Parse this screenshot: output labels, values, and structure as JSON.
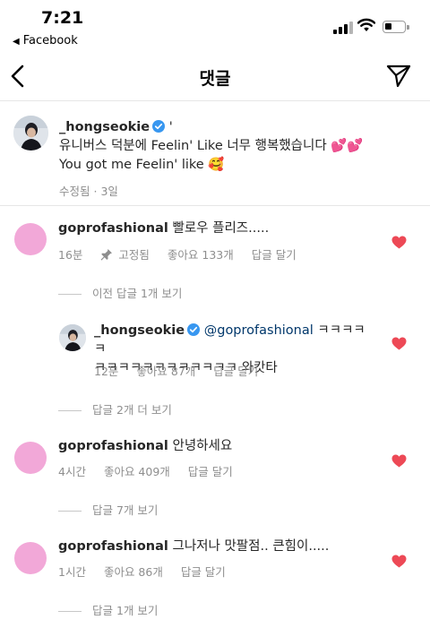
{
  "status_bar": {
    "time": "7:21",
    "back_app": "Facebook",
    "battery_level": 0.35
  },
  "header": {
    "title": "댓글"
  },
  "caption": {
    "username": "_hongseokie",
    "text_after_name": " '",
    "line2": "유니버스 덕분에 Feelin' Like 너무 행복했습니다 💕💕",
    "line3": "You got me Feelin' like 🥰",
    "edited": "수정됨",
    "separator": "·",
    "age": "3일"
  },
  "comments": [
    {
      "username": "goprofashional",
      "text": "빨로우 플리즈.....",
      "age": "16분",
      "pinned": "고정됨",
      "likes": "좋아요 133개",
      "reply": "답글 달기",
      "liked": true,
      "view_replies": "이전 답글 1개 보기"
    },
    {
      "username": "_hongseokie",
      "mention": "@goprofashional",
      "text_line1": " ㅋㅋㅋㅋㅋ",
      "text_line2": "ㅋㅋㅋㅋㅋㅋㅋㅋㅋㅋㅋㅋ 와캇타",
      "age": "12분",
      "likes": "좋아요 87개",
      "reply": "답글 달기",
      "liked": true,
      "view_replies": "답글 2개 더 보기"
    },
    {
      "username": "goprofashional",
      "text": "안녕하세요",
      "age": "4시간",
      "likes": "좋아요 409개",
      "reply": "답글 달기",
      "liked": true,
      "view_replies": "답글 7개 보기"
    },
    {
      "username": "goprofashional",
      "text": "그나저나 맛팔점.. 큰힘이.....",
      "age": "1시간",
      "likes": "좋아요 86개",
      "reply": "답글 달기",
      "liked": true,
      "view_replies": "답글 1개 보기"
    }
  ],
  "colors": {
    "heart": "#ed4956",
    "verified": "#3897f0",
    "avatar_pink": "#f2a8d8",
    "meta_gray": "#8e8e8e"
  }
}
